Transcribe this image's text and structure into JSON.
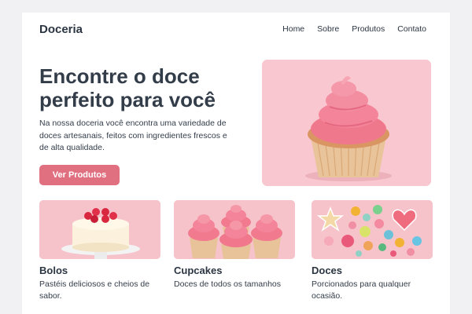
{
  "brand": "Doceria",
  "nav": [
    "Home",
    "Sobre",
    "Produtos",
    "Contato"
  ],
  "hero": {
    "title": "Encontre o doce perfeito para você",
    "text": "Na nossa doceria você encontra uma variedade de doces artesanais, feitos com ingredientes frescos e de alta qualidade.",
    "cta": "Ver Produtos"
  },
  "cards": [
    {
      "title": "Bolos",
      "desc": "Pastéis deliciosos e cheios de sabor."
    },
    {
      "title": "Cupcakes",
      "desc": "Doces de todos os tamanhos"
    },
    {
      "title": "Doces",
      "desc": "Porcionados para qualquer ocasião."
    }
  ],
  "colors": {
    "accent": "#e06f80",
    "background": "#f1f0f2",
    "text": "#333d4a"
  }
}
